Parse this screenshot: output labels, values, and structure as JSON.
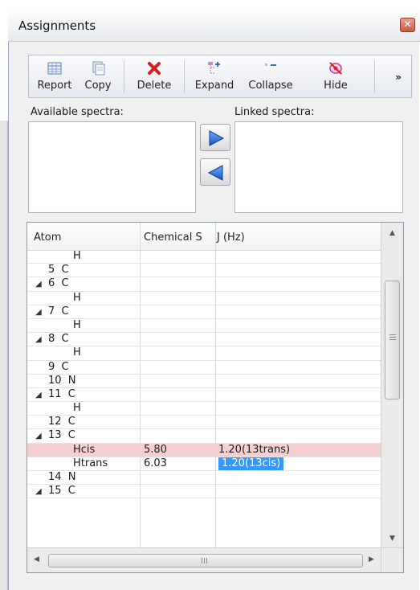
{
  "window": {
    "title": "Assignments"
  },
  "toolbar": {
    "report_label": "Report",
    "copy_label": "Copy",
    "delete_label": "Delete",
    "expand_label": "Expand",
    "collapse_label": "Collapse",
    "hide_label": "Hide",
    "overflow_label": "»"
  },
  "spectra": {
    "available_label": "Available spectra:",
    "linked_label": "Linked spectra:"
  },
  "grid": {
    "columns": [
      "Atom",
      "Chemical S",
      "J (Hz)"
    ],
    "rows": [
      {
        "expander": "",
        "atom": "H",
        "indent": 2,
        "shift": "",
        "j": ""
      },
      {
        "expander": "",
        "atom": "5  C",
        "indent": 1,
        "shift": "",
        "j": ""
      },
      {
        "expander": "◢",
        "atom": "6  C",
        "indent": 1,
        "shift": "",
        "j": ""
      },
      {
        "expander": "",
        "atom": "H",
        "indent": 2,
        "shift": "",
        "j": ""
      },
      {
        "expander": "◢",
        "atom": "7  C",
        "indent": 1,
        "shift": "",
        "j": ""
      },
      {
        "expander": "",
        "atom": "H",
        "indent": 2,
        "shift": "",
        "j": ""
      },
      {
        "expander": "◢",
        "atom": "8  C",
        "indent": 1,
        "shift": "",
        "j": ""
      },
      {
        "expander": "",
        "atom": "H",
        "indent": 2,
        "shift": "",
        "j": ""
      },
      {
        "expander": "",
        "atom": "9  C",
        "indent": 1,
        "shift": "",
        "j": ""
      },
      {
        "expander": "",
        "atom": "10  N",
        "indent": 1,
        "shift": "",
        "j": ""
      },
      {
        "expander": "◢",
        "atom": "11  C",
        "indent": 1,
        "shift": "",
        "j": ""
      },
      {
        "expander": "",
        "atom": "H",
        "indent": 2,
        "shift": "",
        "j": ""
      },
      {
        "expander": "",
        "atom": "12  C",
        "indent": 1,
        "shift": "",
        "j": ""
      },
      {
        "expander": "◢",
        "atom": "13  C",
        "indent": 1,
        "shift": "",
        "j": ""
      },
      {
        "expander": "",
        "atom": "Hcis",
        "indent": 2,
        "shift": "5.80",
        "j": "1.20(13trans)",
        "highlight": true
      },
      {
        "expander": "",
        "atom": "Htrans",
        "indent": 2,
        "shift": "6.03",
        "j": "1.20(13cis)",
        "selected": true
      },
      {
        "expander": "",
        "atom": "14  N",
        "indent": 1,
        "shift": "",
        "j": ""
      },
      {
        "expander": "◢",
        "atom": "15  C",
        "indent": 1,
        "shift": "",
        "j": ""
      }
    ]
  },
  "colors": {
    "highlight_row": "#f6d0d0",
    "selection": "#3399ff",
    "arrow_blue": "#1e6fd9",
    "delete_red": "#d62020"
  }
}
